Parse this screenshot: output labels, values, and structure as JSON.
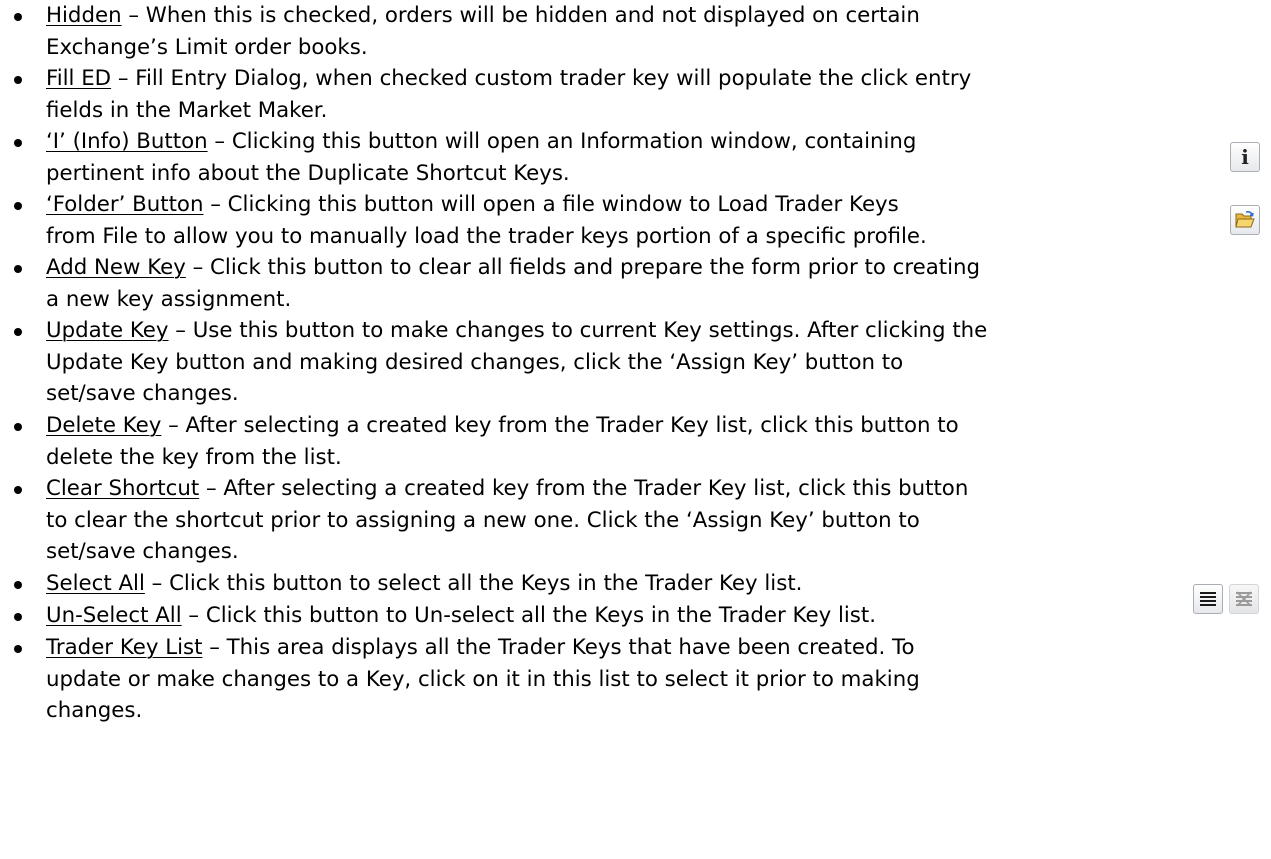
{
  "items": [
    {
      "term": "Hidden",
      "lines": [
        " – When this is checked, orders will be hidden and not displayed on certain",
        "Exchange’s Limit order books."
      ]
    },
    {
      "term": "Fill ED",
      "lines": [
        " – Fill Entry Dialog, when checked custom trader key will populate the click entry",
        "fields in the Market Maker."
      ]
    },
    {
      "term": "‘I’ (Info) Button",
      "lines": [
        " – Clicking this button will open an Information window, containing",
        "pertinent info about the Duplicate Shortcut Keys."
      ],
      "icon": "info-icon"
    },
    {
      "term": "‘Folder’ Button",
      "lines": [
        " – Clicking this button will open a file window to Load Trader Keys",
        "from File to allow you to manually load the trader keys portion of a specific profile."
      ],
      "icon": "open-folder-icon"
    },
    {
      "term": "Add New Key",
      "lines": [
        " – Click this button to clear all fields and prepare the form prior to creating",
        "a new key assignment."
      ]
    },
    {
      "term": "Update Key",
      "lines": [
        " – Use this button to make changes to current Key settings. After clicking the",
        "Update Key button and making desired changes, click the ‘Assign Key’ button to",
        "set/save changes."
      ]
    },
    {
      "term": "Delete Key",
      "lines": [
        " – After selecting a created key from the Trader Key list, click this button to",
        "delete the key from the list."
      ]
    },
    {
      "term": "Clear Shortcut",
      "lines": [
        " – After selecting a created key from the Trader Key list, click this button",
        "to clear the shortcut prior to assigning a new one.  Click the ‘Assign Key’ button to",
        "set/save changes."
      ]
    },
    {
      "term": "Select All",
      "lines": [
        " – Click this button to select all the Keys in the Trader Key list."
      ],
      "icon": "select-all-icon"
    },
    {
      "term": "Un-Select All",
      "lines": [
        " – Click this button to Un-select all the Keys in the Trader Key list."
      ],
      "icon": "unselect-all-icon"
    },
    {
      "term": "Trader Key List",
      "lines": [
        " – This area displays all the Trader Keys that have been created. To",
        "update or make changes to a Key, click on it in this list to select it prior to making",
        "changes."
      ]
    }
  ]
}
